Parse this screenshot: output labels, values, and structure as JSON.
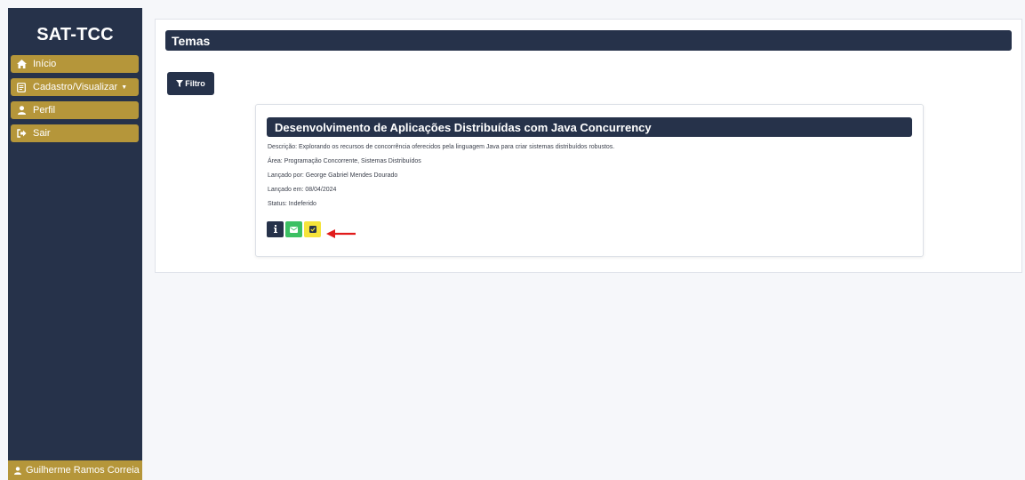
{
  "sidebar": {
    "brand": "SAT-TCC",
    "items": [
      {
        "label": "Início",
        "icon": "home-icon"
      },
      {
        "label": "Cadastro/Visualizar",
        "icon": "clipboard-icon"
      },
      {
        "label": "Perfil",
        "icon": "user-icon"
      },
      {
        "label": "Sair",
        "icon": "sign-out-icon"
      }
    ],
    "user": {
      "label": "Guilherme Ramos Correia",
      "icon": "user-icon"
    }
  },
  "main": {
    "header": "Temas",
    "filter_label": "Filtro",
    "card": {
      "title": "Desenvolvimento de Aplicações Distribuídas com Java Concurrency",
      "description": "Descrição: Explorando os recursos de concorrência oferecidos pela linguagem Java para criar sistemas distribuídos robustos.",
      "area": "Área: Programação Concorrente, Sistemas Distribuídos",
      "launched_by": "Lançado por: George Gabriel Mendes Dourado",
      "launched_on": "Lançado em: 08/04/2024",
      "status": "Status: Indeferido",
      "actions": [
        {
          "icon": "info-icon",
          "color": "#26324a"
        },
        {
          "icon": "envelope-icon",
          "color": "#3cc063"
        },
        {
          "icon": "check-square-icon",
          "color": "#f5e33a"
        }
      ]
    }
  },
  "colors": {
    "navy": "#26324a",
    "gold": "#b5963a",
    "green": "#3cc063",
    "yellow": "#f5e33a",
    "arrow_red": "#e11b1b",
    "background": "#f6f7fa"
  }
}
